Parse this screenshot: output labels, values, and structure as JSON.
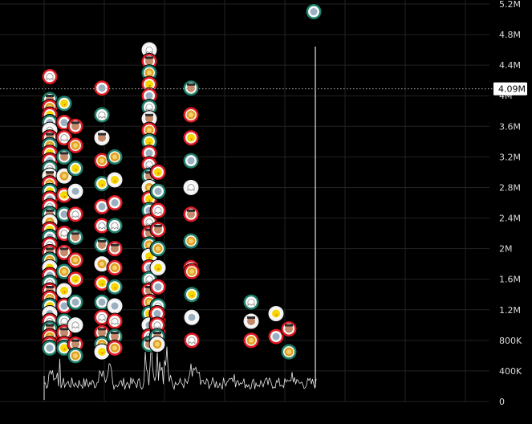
{
  "chart_data": {
    "type": "scatter",
    "title": "",
    "xlabel": "",
    "ylabel": "",
    "ylim": [
      0,
      5200000
    ],
    "y_ticks": [
      {
        "value": 0,
        "label": "0"
      },
      {
        "value": 400000,
        "label": "400K"
      },
      {
        "value": 800000,
        "label": "800K"
      },
      {
        "value": 1200000,
        "label": "1.2M"
      },
      {
        "value": 1600000,
        "label": "1.6M"
      },
      {
        "value": 2000000,
        "label": "2M"
      },
      {
        "value": 2400000,
        "label": "2.4M"
      },
      {
        "value": 2800000,
        "label": "2.8M"
      },
      {
        "value": 3200000,
        "label": "3.2M"
      },
      {
        "value": 3600000,
        "label": "3.6M"
      },
      {
        "value": 4000000,
        "label": "4M"
      },
      {
        "value": 4400000,
        "label": "4.4M"
      },
      {
        "value": 4800000,
        "label": "4.8M"
      },
      {
        "value": 5200000,
        "label": "5.2M"
      }
    ],
    "current_value": {
      "value": 4090000,
      "label": "4.09M"
    },
    "grid": true,
    "colors": {
      "background": "#000000",
      "ring_red": "#e01b24",
      "ring_teal": "#1e7f6a",
      "ring_white": "#f0f0f0",
      "volume_line": "#e6e6e6",
      "tick_text": "#d9d9d9"
    },
    "marker_icons": [
      "ghost-icon",
      "face-icon",
      "lion-icon",
      "chick-icon",
      "sticker-icon"
    ],
    "columns": [
      {
        "x": 0.05,
        "values": [
          4.25,
          3.95,
          3.85,
          3.75,
          3.65,
          3.55,
          3.45,
          3.35,
          3.25,
          3.15,
          3.05,
          2.95,
          2.85,
          2.75,
          2.65,
          2.55,
          2.45,
          2.35,
          2.25,
          2.15,
          2.05,
          1.95,
          1.85,
          1.75,
          1.65,
          1.55,
          1.45,
          1.35,
          1.25,
          1.15,
          1.05,
          0.95,
          0.85,
          0.75,
          0.7
        ]
      },
      {
        "x": 0.075,
        "values": [
          3.9,
          3.65,
          3.45,
          3.2,
          2.95,
          2.7,
          2.45,
          2.2,
          1.95,
          1.7,
          1.45,
          1.25,
          1.05,
          0.9,
          0.75,
          0.7
        ]
      },
      {
        "x": 0.1,
        "values": [
          3.6,
          3.35,
          3.05,
          2.75,
          2.45,
          2.15,
          1.85,
          1.6,
          1.3,
          1.0,
          0.75,
          0.6
        ]
      },
      {
        "x": 0.14,
        "values": [
          4.1,
          3.75,
          3.45,
          3.15,
          2.85,
          2.55,
          2.3,
          2.05,
          1.8,
          1.55,
          1.3,
          1.1,
          0.9,
          0.75,
          0.65
        ]
      },
      {
        "x": 0.175,
        "values": [
          3.2,
          2.9,
          2.6,
          2.3,
          2.0,
          1.75,
          1.5,
          1.25,
          1.05,
          0.85,
          0.7
        ]
      },
      {
        "x": 0.24,
        "values": [
          4.6,
          4.45,
          4.3,
          4.15,
          4.0,
          3.85,
          3.7,
          3.55,
          3.4,
          3.25,
          3.1,
          2.95,
          2.8,
          2.65,
          2.5,
          2.35,
          2.2,
          2.05,
          1.9,
          1.75,
          1.6,
          1.45,
          1.3,
          1.15,
          1.0,
          0.85,
          0.75
        ]
      },
      {
        "x": 0.255,
        "values": [
          3.0,
          2.75,
          2.5,
          2.25,
          2.0,
          1.75,
          1.5,
          1.25,
          1.05,
          0.9
        ]
      },
      {
        "x": 0.3,
        "values": [
          4.1,
          3.75,
          3.45,
          3.15,
          2.8,
          2.45,
          2.1,
          1.75,
          1.4,
          1.1
        ]
      },
      {
        "x": 0.35,
        "values": [
          1.15,
          1.0,
          0.85,
          0.75
        ]
      },
      {
        "x": 0.4,
        "values": [
          1.7,
          1.4,
          1.1,
          0.8
        ]
      },
      {
        "x": 0.44,
        "values": [
          1.3,
          1.05,
          0.8
        ]
      },
      {
        "x": 0.47,
        "values": [
          1.15,
          0.85
        ]
      },
      {
        "x": 0.52,
        "values": [
          0.95,
          0.65
        ]
      },
      {
        "x": 0.5,
        "values": [
          5.1
        ]
      }
    ],
    "volume_x_range": [
      0.06,
      0.52
    ]
  }
}
